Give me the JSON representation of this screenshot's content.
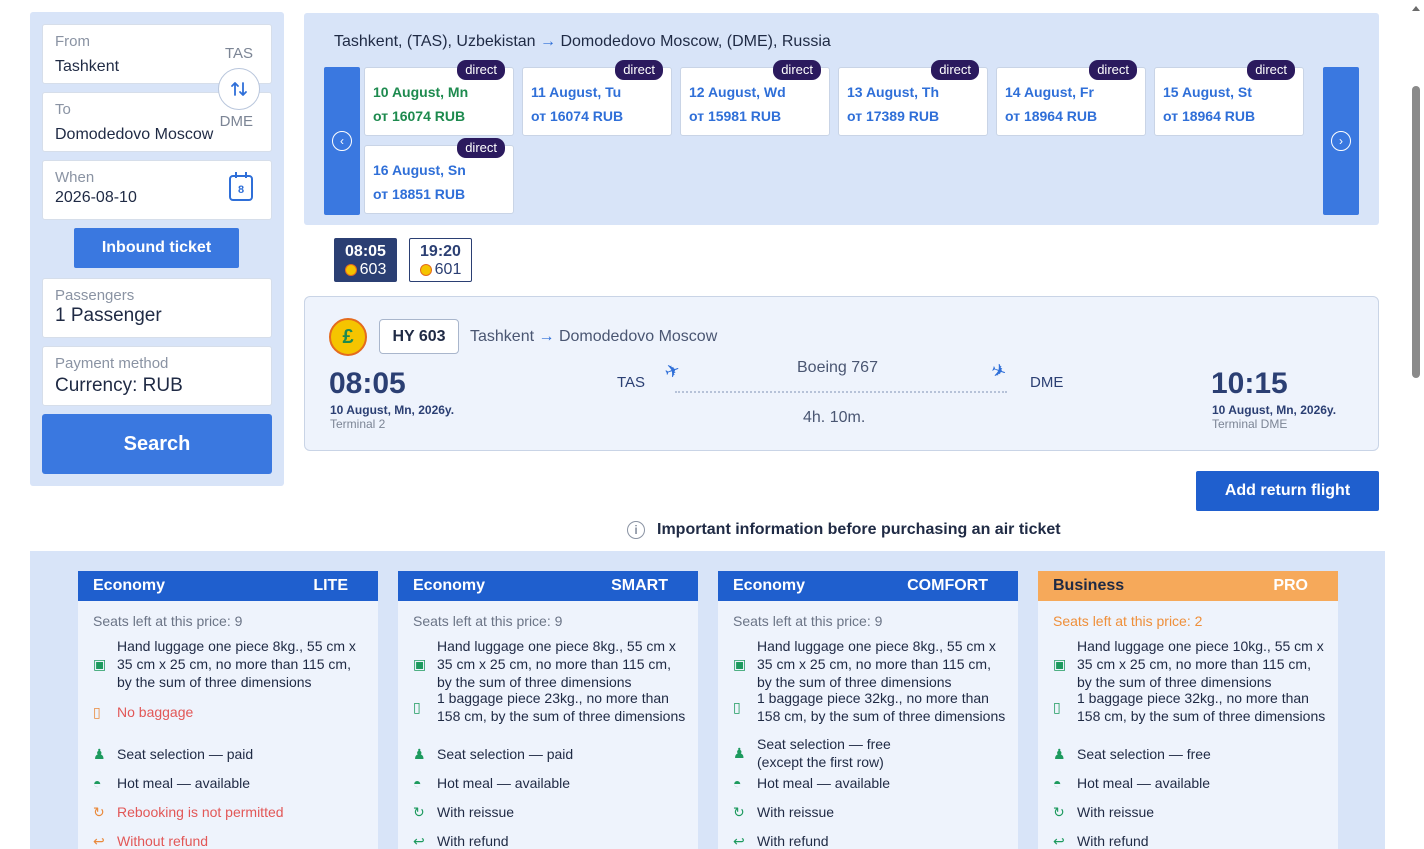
{
  "search": {
    "from": {
      "label": "From",
      "value": "Tashkent",
      "code": "TAS"
    },
    "to": {
      "label": "To",
      "value": "Domodedovo Moscow",
      "code": "DME"
    },
    "when": {
      "label": "When",
      "value": "2026-08-10",
      "calendar_day": "8"
    },
    "inbound_label": "Inbound ticket",
    "passengers": {
      "label": "Passengers",
      "value": "1 Passenger"
    },
    "payment": {
      "label": "Payment method",
      "value": "Currency: RUB"
    },
    "search_label": "Search"
  },
  "dates": {
    "route_from": "Tashkent, (TAS), Uzbekistan",
    "route_arrow": "→",
    "route_to": "Domodedovo Moscow, (DME), Russia",
    "items": [
      {
        "date": "10 August, Mn",
        "price": "от 16074 RUB",
        "badge": "direct"
      },
      {
        "date": "11 August, Tu",
        "price": "от 16074 RUB",
        "badge": "direct"
      },
      {
        "date": "12 August, Wd",
        "price": "от 15981 RUB",
        "badge": "direct"
      },
      {
        "date": "13 August, Th",
        "price": "от 17389 RUB",
        "badge": "direct"
      },
      {
        "date": "14 August, Fr",
        "price": "от 18964 RUB",
        "badge": "direct"
      },
      {
        "date": "15 August, St",
        "price": "от 18964 RUB",
        "badge": "direct"
      },
      {
        "date": "16 August, Sn",
        "price": "от 18851 RUB",
        "badge": "direct"
      }
    ]
  },
  "times": [
    {
      "time": "08:05",
      "flight": "603"
    },
    {
      "time": "19:20",
      "flight": "601"
    }
  ],
  "flight": {
    "number": "HY 603",
    "route_from": "Tashkent",
    "route_arrow": "→",
    "route_to": "Domodedovo Moscow",
    "dep_time": "08:05",
    "dep_date": "10 August, Mn, 2026y.",
    "dep_terminal": "Terminal 2",
    "dep_code": "TAS",
    "aircraft": "Boeing 767",
    "duration": "4h. 10m.",
    "arr_code": "DME",
    "arr_time": "10:15",
    "arr_date": "10 August, Mn, 2026y.",
    "arr_terminal": "Terminal DME"
  },
  "add_return_label": "Add return flight",
  "info_text": "Important information before purchasing an air ticket",
  "tariffs": [
    {
      "cls": "Economy",
      "tier": "LITE",
      "seats": "Seats left at this price: 9",
      "hand": "Hand luggage one piece 8kg., 55 cm x 35 cm x 25 cm, no more than 115 cm, by the sum of three dimensions",
      "baggage": "No baggage",
      "seat": "Seat selection — paid",
      "meal": "Hot meal — available",
      "reissue": "Rebooking is not permitted",
      "refund": "Without refund"
    },
    {
      "cls": "Economy",
      "tier": "SMART",
      "seats": "Seats left at this price: 9",
      "hand": "Hand luggage one piece 8kg., 55 cm x 35 cm x 25 cm, no more than 115 cm, by the sum of three dimensions",
      "baggage": "1 baggage piece 23kg., no more than 158 cm, by the sum of three dimensions",
      "seat": "Seat selection — paid",
      "meal": "Hot meal — available",
      "reissue": "With reissue",
      "refund": "With refund"
    },
    {
      "cls": "Economy",
      "tier": "COMFORT",
      "seats": "Seats left at this price: 9",
      "hand": "Hand luggage one piece 8kg., 55 cm x 35 cm x 25 cm, no more than 115 cm, by the sum of three dimensions",
      "baggage": "1 baggage piece 32kg., no more than 158 cm, by the sum of three dimensions",
      "seat": "Seat selection — free (except the first row)",
      "meal": "Hot meal — available",
      "reissue": "With reissue",
      "refund": "With refund"
    },
    {
      "cls": "Business",
      "tier": "PRO",
      "seats": "Seats left at this price: 2",
      "hand": "Hand luggage one piece 10kg., 55 cm x 35 cm x 25 cm, no more than 115 cm, by the sum of three dimensions",
      "baggage": "1 baggage piece 32kg., no more than 158 cm, by the sum of three dimensions",
      "seat": "Seat selection — free",
      "meal": "Hot meal — available",
      "reissue": "With reissue",
      "refund": "With refund"
    }
  ],
  "colors": {
    "primary": "#3a78e0",
    "dark": "#2b3f73",
    "badge": "#2b1a5e",
    "green": "#1d8a4e",
    "business": "#f6a95a",
    "negative": "#e25757"
  }
}
